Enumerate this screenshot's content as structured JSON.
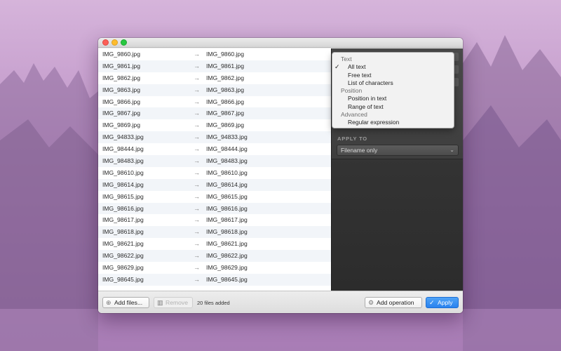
{
  "colors": {
    "accent": "#2a82ee",
    "desktop_top": "#c9a2cf",
    "panel_dark": "#3a3a3a"
  },
  "window": {
    "traffic_lights": [
      "close",
      "minimize",
      "maximize"
    ]
  },
  "files": [
    {
      "original": "IMG_9860.jpg",
      "renamed": "IMG_9860.jpg"
    },
    {
      "original": "IMG_9861.jpg",
      "renamed": "IMG_9861.jpg"
    },
    {
      "original": "IMG_9862.jpg",
      "renamed": "IMG_9862.jpg"
    },
    {
      "original": "IMG_9863.jpg",
      "renamed": "IMG_9863.jpg"
    },
    {
      "original": "IMG_9866.jpg",
      "renamed": "IMG_9866.jpg"
    },
    {
      "original": "IMG_9867.jpg",
      "renamed": "IMG_9867.jpg"
    },
    {
      "original": "IMG_9869.jpg",
      "renamed": "IMG_9869.jpg"
    },
    {
      "original": "IMG_94833.jpg",
      "renamed": "IMG_94833.jpg"
    },
    {
      "original": "IMG_98444.jpg",
      "renamed": "IMG_98444.jpg"
    },
    {
      "original": "IMG_98483.jpg",
      "renamed": "IMG_98483.jpg"
    },
    {
      "original": "IMG_98610.jpg",
      "renamed": "IMG_98610.jpg"
    },
    {
      "original": "IMG_98614.jpg",
      "renamed": "IMG_98614.jpg"
    },
    {
      "original": "IMG_98615.jpg",
      "renamed": "IMG_98615.jpg"
    },
    {
      "original": "IMG_98616.jpg",
      "renamed": "IMG_98616.jpg"
    },
    {
      "original": "IMG_98617.jpg",
      "renamed": "IMG_98617.jpg"
    },
    {
      "original": "IMG_98618.jpg",
      "renamed": "IMG_98618.jpg"
    },
    {
      "original": "IMG_98621.jpg",
      "renamed": "IMG_98621.jpg"
    },
    {
      "original": "IMG_98622.jpg",
      "renamed": "IMG_98622.jpg"
    },
    {
      "original": "IMG_98629.jpg",
      "renamed": "IMG_98629.jpg"
    },
    {
      "original": "IMG_98645.jpg",
      "renamed": "IMG_98645.jpg"
    }
  ],
  "arrow_glyph": "→",
  "menu": {
    "items": [
      {
        "type": "header",
        "label": "Text"
      },
      {
        "type": "item",
        "label": "All text",
        "checked": true
      },
      {
        "type": "item",
        "label": "Free text"
      },
      {
        "type": "item",
        "label": "List of characters"
      },
      {
        "type": "header",
        "label": "Position"
      },
      {
        "type": "item",
        "label": "Position in text"
      },
      {
        "type": "item",
        "label": "Range of text"
      },
      {
        "type": "header",
        "label": "Advanced"
      },
      {
        "type": "item",
        "label": "Regular expression"
      }
    ],
    "check_glyph": "✓"
  },
  "panel": {
    "apply_to_label": "APPLY TO",
    "apply_to_value": "Filename only"
  },
  "toolbar": {
    "add_files_label": "Add files...",
    "add_files_icon": "plus-circle-icon",
    "remove_label": "Remove",
    "remove_icon": "trash-icon",
    "status": "20 files added",
    "add_operation_label": "Add operation",
    "add_operation_icon": "gear-icon",
    "apply_label": "Apply",
    "apply_icon": "checkmark-icon"
  }
}
